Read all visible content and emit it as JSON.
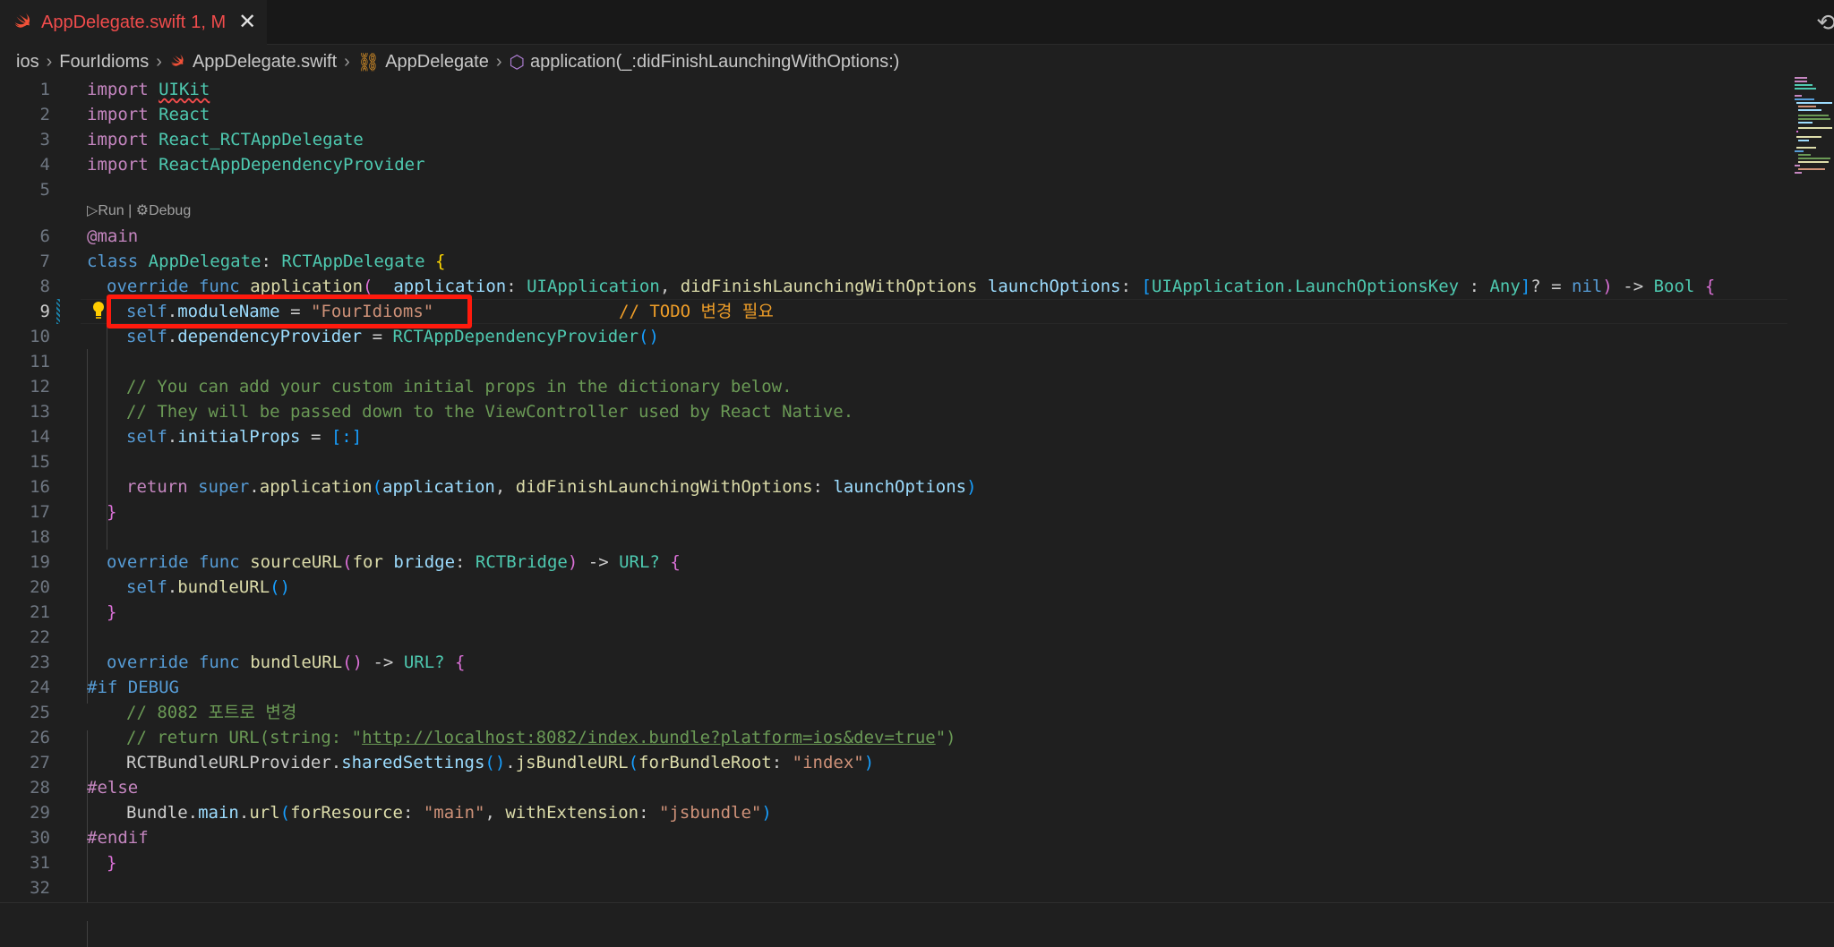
{
  "tab": {
    "title": "AppDelegate.swift",
    "status": "1, M",
    "close": "✕"
  },
  "breadcrumb": {
    "folder1": "ios",
    "folder2": "FourIdioms",
    "file": "AppDelegate.swift",
    "class": "AppDelegate",
    "method": "application(_:didFinishLaunchingWithOptions:)"
  },
  "codelens": {
    "run": "Run",
    "separator": "|",
    "debug": "Debug"
  },
  "line_numbers": [
    "1",
    "2",
    "3",
    "4",
    "5",
    "6",
    "7",
    "8",
    "9",
    "10",
    "11",
    "12",
    "13",
    "14",
    "15",
    "16",
    "17",
    "18",
    "19",
    "20",
    "21",
    "22",
    "23",
    "24",
    "25",
    "26",
    "27",
    "28",
    "29",
    "30",
    "31",
    "32"
  ],
  "current_line": "9",
  "code": {
    "l1": {
      "kw": "import",
      "mod": "UIKit"
    },
    "l2": {
      "kw": "import",
      "mod": "React"
    },
    "l3": {
      "kw": "import",
      "mod": "React_RCTAppDelegate"
    },
    "l4": {
      "kw": "import",
      "mod": "ReactAppDependencyProvider"
    },
    "l6": {
      "attr": "@main"
    },
    "l7": {
      "kw": "class",
      "name": "AppDelegate",
      "colon": ":",
      "parent": "RCTAppDelegate",
      "brace": "{"
    },
    "l8": {
      "override": "override",
      "func": "func",
      "name": "application",
      "p1": "_ application",
      "t1": "UIApplication",
      "p2": "didFinishLaunchingWithOptions",
      "p3": "launchOptions",
      "t2a": "UIApplication.LaunchOptionsKey",
      "sep": ":",
      "t2b": "Any",
      "nil": "nil",
      "arrow": "->",
      "ret": "Bool"
    },
    "l9": {
      "self": "self",
      "prop": "moduleName",
      "eq": "=",
      "str": "\"FourIdioms\"",
      "comment": "// TODO 변경 필요"
    },
    "l10": {
      "self": "self",
      "prop": "dependencyProvider",
      "eq": "=",
      "call": "RCTAppDependencyProvider"
    },
    "l12": {
      "comment": "// You can add your custom initial props in the dictionary below."
    },
    "l13": {
      "comment": "// They will be passed down to the ViewController used by React Native."
    },
    "l14": {
      "self": "self",
      "prop": "initialProps",
      "eq": "=",
      "val": "[:]"
    },
    "l16": {
      "ret": "return",
      "sup": "super",
      "fn": "application",
      "a1": "application",
      "a2": "didFinishLaunchingWithOptions",
      "a3": "launchOptions"
    },
    "l17": {
      "brace": "}"
    },
    "l19": {
      "override": "override",
      "func": "func",
      "name": "sourceURL",
      "p1": "for",
      "p2": "bridge",
      "t1": "RCTBridge",
      "arrow": "->",
      "ret": "URL?",
      "brace": "{"
    },
    "l20": {
      "self": "self",
      "fn": "bundleURL"
    },
    "l21": {
      "brace": "}"
    },
    "l23": {
      "override": "override",
      "func": "func",
      "name": "bundleURL",
      "arrow": "->",
      "ret": "URL?",
      "brace": "{"
    },
    "l24": {
      "dir": "#if",
      "flag": "DEBUG"
    },
    "l25": {
      "comment": "// 8082 포트로 변경"
    },
    "l26": {
      "c1": "// return URL(string: \"",
      "url": "http://localhost:8082/index.bundle?platform=ios&dev=true",
      "c2": "\")"
    },
    "l27": {
      "cls": "RCTBundleURLProvider",
      "m1": "sharedSettings",
      "m2": "jsBundleURL",
      "p": "forBundleRoot",
      "str": "\"index\""
    },
    "l28": {
      "dir": "#else"
    },
    "l29": {
      "cls": "Bundle",
      "m1": "main",
      "m2": "url",
      "p1": "forResource",
      "s1": "\"main\"",
      "p2": "withExtension",
      "s2": "\"jsbundle\""
    },
    "l30": {
      "dir": "#endif"
    },
    "l31": {
      "brace": "}"
    }
  }
}
